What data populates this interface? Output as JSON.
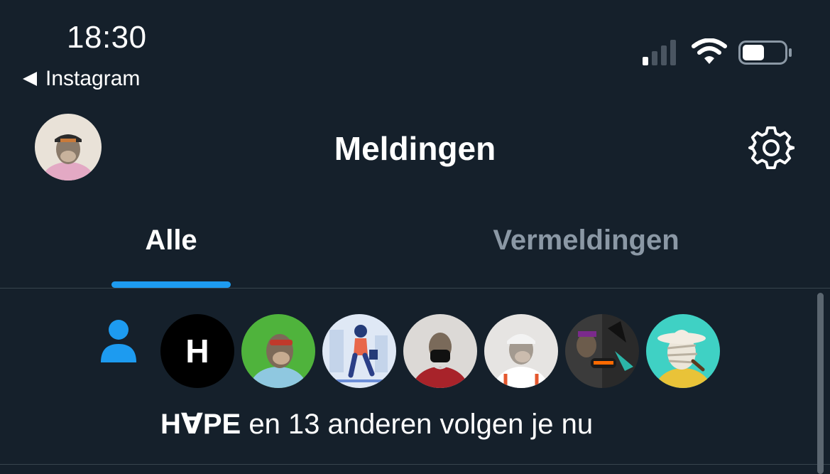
{
  "status_bar": {
    "time": "18:30",
    "back_app": "Instagram",
    "signal_bars": 1,
    "signal_bars_total": 4,
    "battery_level": 0.5
  },
  "header": {
    "title": "Meldingen",
    "avatar_icon": "profile-avatar",
    "settings_icon": "gear-icon"
  },
  "tabs": [
    {
      "label": "Alle",
      "active": true
    },
    {
      "label": "Vermeldingen",
      "active": false
    }
  ],
  "notification": {
    "icon": "person-icon",
    "avatars": [
      {
        "name": "hype-avatar",
        "bg": "#000000",
        "letter": "H"
      },
      {
        "name": "ape-green-avatar",
        "bg": "#4fb33c"
      },
      {
        "name": "shopper-avatar",
        "bg": "#dfe8f5"
      },
      {
        "name": "ape-red-jersey-avatar",
        "bg": "#dcd9d6"
      },
      {
        "name": "ape-white-cap-avatar",
        "bg": "#e6e4e2"
      },
      {
        "name": "ape-dark-avatar",
        "bg": "#2a2a2a"
      },
      {
        "name": "mummy-hat-avatar",
        "bg": "#3fd1c4"
      }
    ],
    "actor": "H∀PE",
    "text": " en 13 anderen volgen je nu"
  },
  "colors": {
    "background": "#15202b",
    "accent": "#1d9bf0",
    "muted": "#8b98a5",
    "divider": "#38444d"
  }
}
